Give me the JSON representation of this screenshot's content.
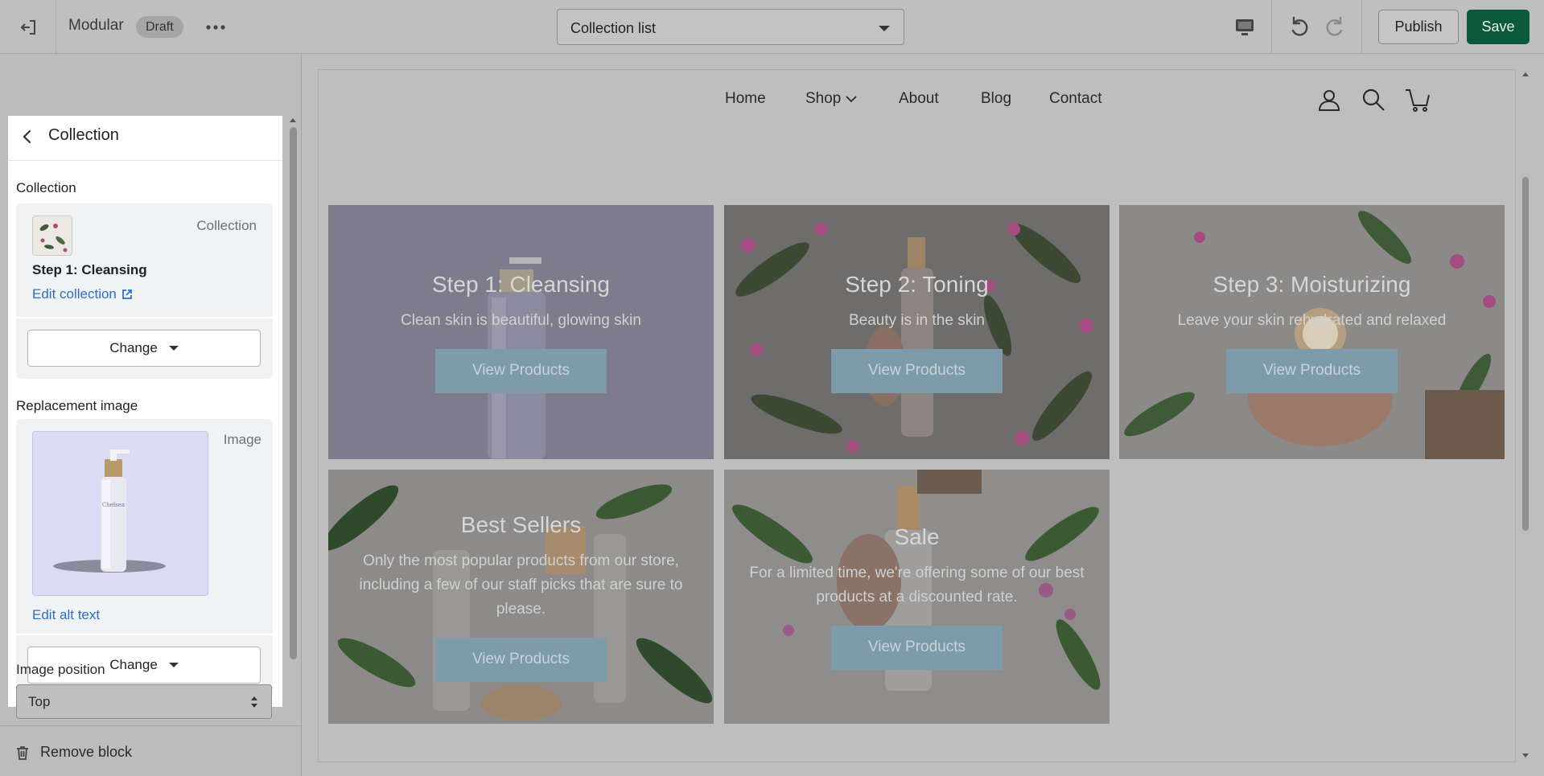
{
  "topbar": {
    "theme_name": "Modular",
    "status_badge": "Draft",
    "template_select": "Collection list",
    "publish_label": "Publish",
    "save_label": "Save",
    "save_color": "#0b5a3c"
  },
  "sidebar": {
    "panel_title": "Collection",
    "collection_section_label": "Collection",
    "collection_card": {
      "type_label": "Collection",
      "name": "Step 1: Cleansing",
      "edit_link": "Edit collection",
      "change_label": "Change"
    },
    "replacement_section_label": "Replacement image",
    "image_card": {
      "type_label": "Image",
      "edit_link": "Edit alt text",
      "change_label": "Change"
    },
    "image_position_label": "Image position",
    "image_position_value": "Top",
    "remove_label": "Remove block"
  },
  "preview": {
    "nav": {
      "links": [
        "Home",
        "Shop",
        "About",
        "Blog",
        "Contact"
      ],
      "icons": [
        "account-icon",
        "search-icon",
        "cart-icon"
      ]
    },
    "tiles": [
      {
        "title": "Step 1: Cleansing",
        "subtitle": "Clean skin is beautiful, glowing skin",
        "button": "View Products"
      },
      {
        "title": "Step 2: Toning",
        "subtitle": "Beauty is in the skin",
        "button": "View Products"
      },
      {
        "title": "Step 3: Moisturizing",
        "subtitle": "Leave your skin rehydrated and relaxed",
        "button": "View Products"
      },
      {
        "title": "Best Sellers",
        "subtitle": "Only the most popular products from our store, including a few of our staff picks that are sure to please.",
        "button": "View Products"
      },
      {
        "title": "Sale",
        "subtitle": "For a limited time, we're offering some of our best products at a discounted rate.",
        "button": "View Products"
      }
    ]
  }
}
